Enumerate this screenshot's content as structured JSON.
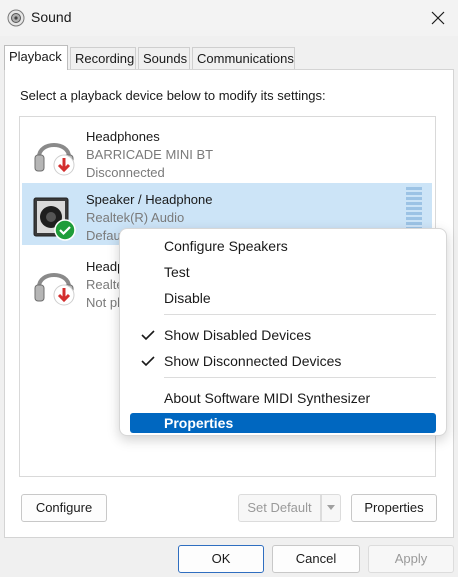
{
  "window": {
    "title": "Sound",
    "app_icon": "speaker-icon",
    "close_icon": "close-icon"
  },
  "tabs": [
    {
      "label": "Playback",
      "active": true
    },
    {
      "label": "Recording",
      "active": false
    },
    {
      "label": "Sounds",
      "active": false
    },
    {
      "label": "Communications",
      "active": false
    }
  ],
  "instruction": "Select a playback device below to modify its settings:",
  "devices": [
    {
      "name": "Headphones",
      "line2": "BARRICADE MINI BT",
      "line3": "Disconnected",
      "icon": "headphones-icon",
      "status_icon": "red-down-arrow-icon",
      "selected": false
    },
    {
      "name": "Speaker / Headphone",
      "line2": "Realtek(R) Audio",
      "line3": "Default Device",
      "icon": "speaker-icon",
      "status_icon": "green-check-icon",
      "selected": true
    },
    {
      "name": "Headphones",
      "line2": "Realtek(R) Audio",
      "line3": "Not plugged in",
      "icon": "headphones-icon",
      "status_icon": "red-down-arrow-icon",
      "selected": false
    }
  ],
  "context_menu": {
    "items": [
      {
        "label": "Configure Speakers",
        "checked": false,
        "highlighted": false
      },
      {
        "label": "Test",
        "checked": false,
        "highlighted": false
      },
      {
        "label": "Disable",
        "checked": false,
        "highlighted": false
      },
      {
        "label": "Show Disabled Devices",
        "checked": true,
        "highlighted": false
      },
      {
        "label": "Show Disconnected Devices",
        "checked": true,
        "highlighted": false
      },
      {
        "label": "About Software MIDI Synthesizer",
        "checked": false,
        "highlighted": false
      },
      {
        "label": "Properties",
        "checked": false,
        "highlighted": true
      }
    ]
  },
  "panel_buttons": {
    "configure": "Configure",
    "set_default": "Set Default",
    "properties": "Properties"
  },
  "footer_buttons": {
    "ok": "OK",
    "cancel": "Cancel",
    "apply": "Apply"
  },
  "colors": {
    "selection": "#cce4f7",
    "menu_highlight": "#0067c0",
    "status_green": "#1f9d3a",
    "status_red": "#d32f2f"
  }
}
